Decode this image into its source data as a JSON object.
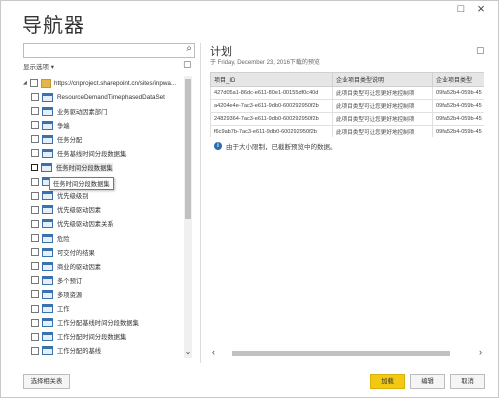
{
  "window": {
    "title": "导航器",
    "maximize_icon": "□",
    "close_icon": "×"
  },
  "left": {
    "search_placeholder": "",
    "display_options": "显示选项 ▾",
    "root": "https://cnproject.sharepoint.cn/sites/inpwa...",
    "items": [
      "ResourceDemandTimephasedDataSet",
      "业务驱动因素部门",
      "争端",
      "任务分配",
      "任务基线时间分段数据集",
      "任务时间分段数据集",
      "任务",
      "优先级级别",
      "优先级驱动因素",
      "优先级驱动因素关系",
      "危险",
      "可交付的结果",
      "商业的驱动因素",
      "多个预订",
      "多项资源",
      "工作",
      "工作分配基线时间分段数据集",
      "工作分配时间分段数据集",
      "工作分配的基线"
    ],
    "tooltip": "任务时间分段数据集"
  },
  "right": {
    "title": "计划",
    "subtitle": "于 Friday, December 23, 2016下载的预览",
    "columns": [
      "项目_ID",
      "企业项目类型说明",
      "企业项目类型"
    ],
    "rows": [
      [
        "427d05a1-86dc-e611-80e1-00155df0c40d",
        "此项目类型可让您更好地控制项",
        "09fa52b4-059b-45"
      ],
      [
        "a4204e4e-7ac3-e611-9db0-600292950f2b",
        "此项目类型可让您更好地控制项",
        "09fa52b4-059b-45"
      ],
      [
        "24829364-7ac3-e611-9db0-600292950f2b",
        "此项目类型可让您更好地控制项",
        "09fa52b4-059b-45"
      ],
      [
        "f6c9ab7b-7ac3-e611-9db0-600292950f2b",
        "此项目类型可让您更好地控制项",
        "09fa52b4-059b-45"
      ]
    ],
    "info": "由于大小限制，已截断预览中的数据。"
  },
  "buttons": {
    "select_related": "选择相关表",
    "load": "加载",
    "edit": "编辑",
    "cancel": "取消"
  },
  "colors": {
    "primary": "#f2c811",
    "accent": "#2b6cb0"
  }
}
